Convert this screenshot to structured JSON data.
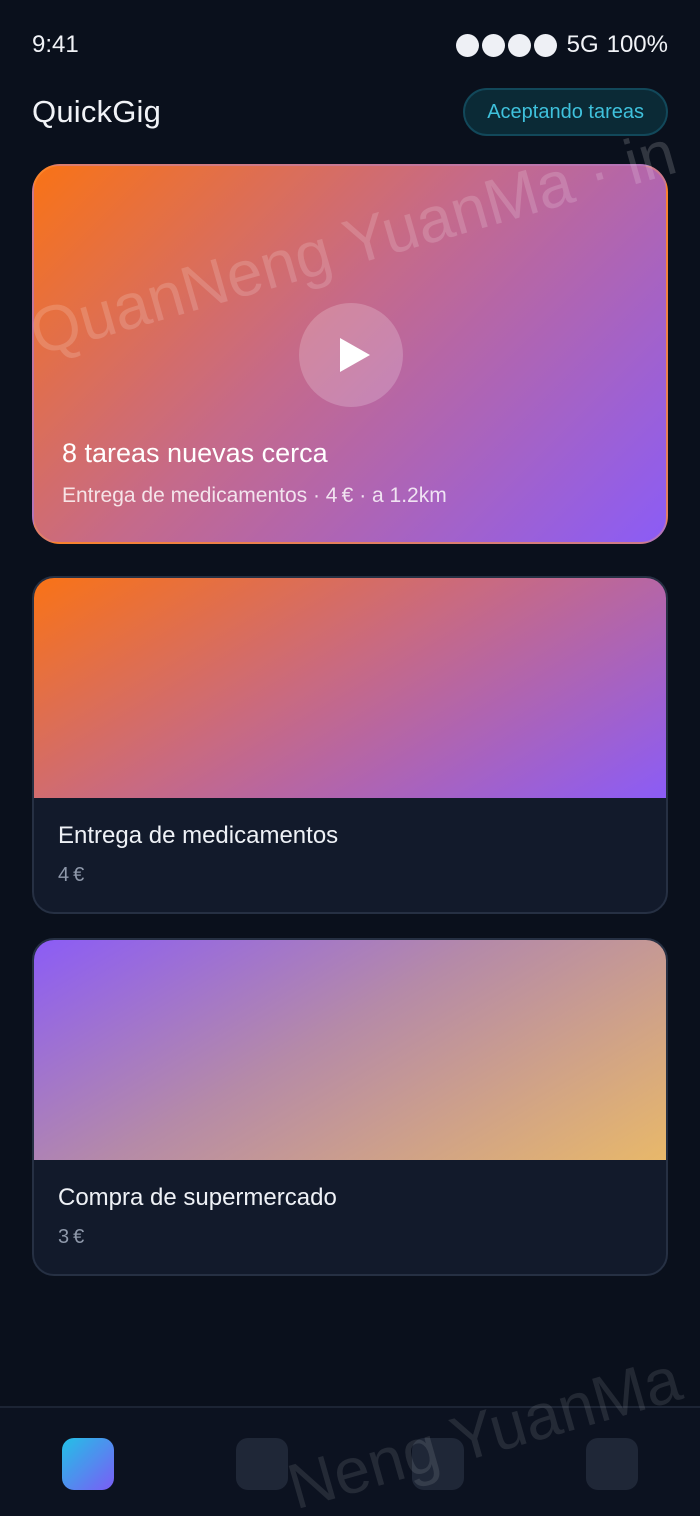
{
  "status_bar": {
    "time": "9:41",
    "network": "5G",
    "battery": "100%",
    "signal_bars": 4
  },
  "header": {
    "title": "QuickGig",
    "status_pill": "Aceptando tareas"
  },
  "hero": {
    "title": "8 tareas nuevas cerca",
    "subtitle": "Entrega de medicamentos · 4 € · a 1.2km",
    "play_icon": "play-icon"
  },
  "tasks": [
    {
      "name": "Entrega de medicamentos",
      "price": "4 €"
    },
    {
      "name": "Compra de supermercado",
      "price": "3 €"
    }
  ],
  "watermark": {
    "text_top": "QuanNeng YuanMa · in",
    "text_bottom": "Neng YuanMa"
  },
  "nav": {
    "items": [
      {
        "icon": "home-icon",
        "active": true
      },
      {
        "icon": "tasks-icon",
        "active": false
      },
      {
        "icon": "messages-icon",
        "active": false
      },
      {
        "icon": "profile-icon",
        "active": false
      }
    ]
  },
  "colors": {
    "background": "#0a101c",
    "accent": "#3fc1dc",
    "gradient_orange": "#f97316",
    "gradient_purple": "#8b5cf6",
    "gradient_gold": "#e8b86a"
  }
}
